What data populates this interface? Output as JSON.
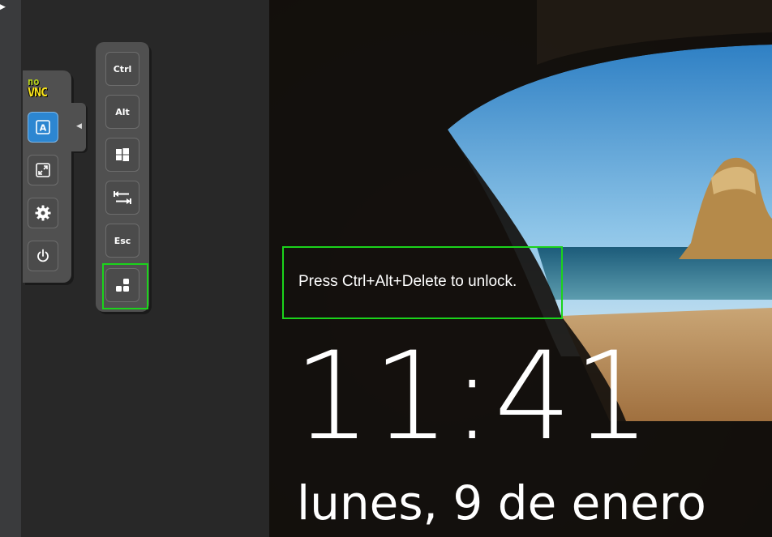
{
  "novnc": {
    "logo": {
      "no": "no",
      "vnc": "VNC"
    },
    "control_bar": [
      {
        "name": "keyboard-button",
        "icon": "keyboard-icon",
        "active": true
      },
      {
        "name": "fullscreen-button",
        "icon": "fullscreen-icon",
        "active": false
      },
      {
        "name": "settings-button",
        "icon": "gear-icon",
        "active": false
      },
      {
        "name": "power-button",
        "icon": "power-icon",
        "active": false
      }
    ],
    "extra_keys": {
      "ctrl_label": "Ctrl",
      "alt_label": "Alt",
      "windows_icon": "windows-icon",
      "tab_icon": "tab-icon",
      "esc_label": "Esc",
      "ctrl_alt_del_icon": "ctrl-alt-del-icon"
    },
    "highlight_color": "#1bd31b",
    "accent_color": "#2c86d1"
  },
  "lockscreen": {
    "unlock_prompt": "Press Ctrl+Alt+Delete to unlock.",
    "time": "11:41",
    "date": "lunes, 9 de enero"
  }
}
